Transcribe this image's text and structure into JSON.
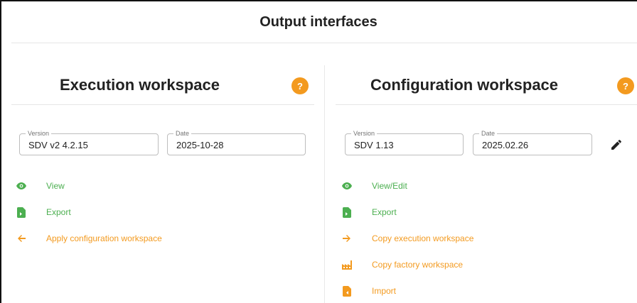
{
  "page": {
    "title": "Output interfaces"
  },
  "execution": {
    "title": "Execution workspace",
    "help": "?",
    "version_legend": "Version",
    "version_value": "SDV v2 4.2.15",
    "date_legend": "Date",
    "date_value": "2025-10-28",
    "actions": [
      {
        "label": "View",
        "icon": "eye-icon",
        "color": "#4caf50"
      },
      {
        "label": "Export",
        "icon": "file-export-icon",
        "color": "#4caf50"
      },
      {
        "label": "Apply configuration workspace",
        "icon": "arrow-left-icon",
        "color": "#f39a1f"
      }
    ]
  },
  "configuration": {
    "title": "Configuration workspace",
    "help": "?",
    "version_legend": "Version",
    "version_value": "SDV 1.13",
    "date_legend": "Date",
    "date_value": "2025.02.26",
    "edit_icon": "pencil-icon",
    "actions": [
      {
        "label": "View/Edit",
        "icon": "eye-icon",
        "color": "#4caf50"
      },
      {
        "label": "Export",
        "icon": "file-export-icon",
        "color": "#4caf50"
      },
      {
        "label": "Copy execution workspace",
        "icon": "arrow-right-icon",
        "color": "#f39a1f"
      },
      {
        "label": "Copy factory workspace",
        "icon": "factory-icon",
        "color": "#f39a1f"
      },
      {
        "label": "Import",
        "icon": "file-import-icon",
        "color": "#f39a1f"
      }
    ]
  },
  "colors": {
    "green": "#4caf50",
    "orange": "#f39a1f",
    "help_badge": "#f39a1f"
  }
}
